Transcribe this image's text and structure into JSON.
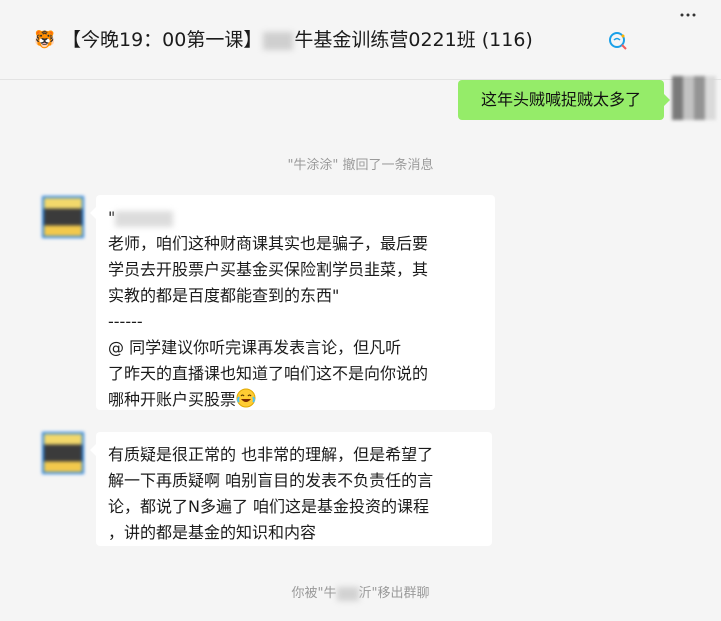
{
  "header": {
    "icon": "tiger-icon",
    "title_prefix": "【今晚19：00第一课】",
    "title_suffix": "牛基金训练营0221班 (116)",
    "search_icon": "search-chat-icon",
    "more_icon": "more-icon"
  },
  "messages": [
    {
      "type": "sent",
      "text": "这年头贼喊捉贼太多了"
    },
    {
      "type": "system",
      "text": "\"牛涂涂\" 撤回了一条消息"
    },
    {
      "type": "received",
      "lines": [
        "\"",
        "老师，咱们这种财商课其实也是骗子，最后要",
        "学员去开股票户买基金买保险割学员韭菜，其",
        "实教的都是百度都能查到的东西\"",
        "------",
        "@        同学建议你听完课再发表言论，但凡听",
        "了昨天的直播课也知道了咱们这不是向你说的",
        "哪种开账户买股票"
      ],
      "emoji": "laughing-crying-emoji"
    },
    {
      "type": "received",
      "lines": [
        "有质疑是很正常的 也非常的理解，但是希望了",
        "解一下再质疑啊  咱别盲目的发表不负责任的言",
        "论，都说了N多遍了  咱们这是基金投资的课程",
        "，讲的都是基金的知识和内容"
      ]
    },
    {
      "type": "system",
      "text_prefix": "你被\"牛",
      "text_suffix": "沂\"移出群聊"
    }
  ],
  "colors": {
    "background": "#f5f5f5",
    "sent_bubble": "#95ec69",
    "received_bubble": "#ffffff",
    "system_text": "#9a9a9a"
  }
}
